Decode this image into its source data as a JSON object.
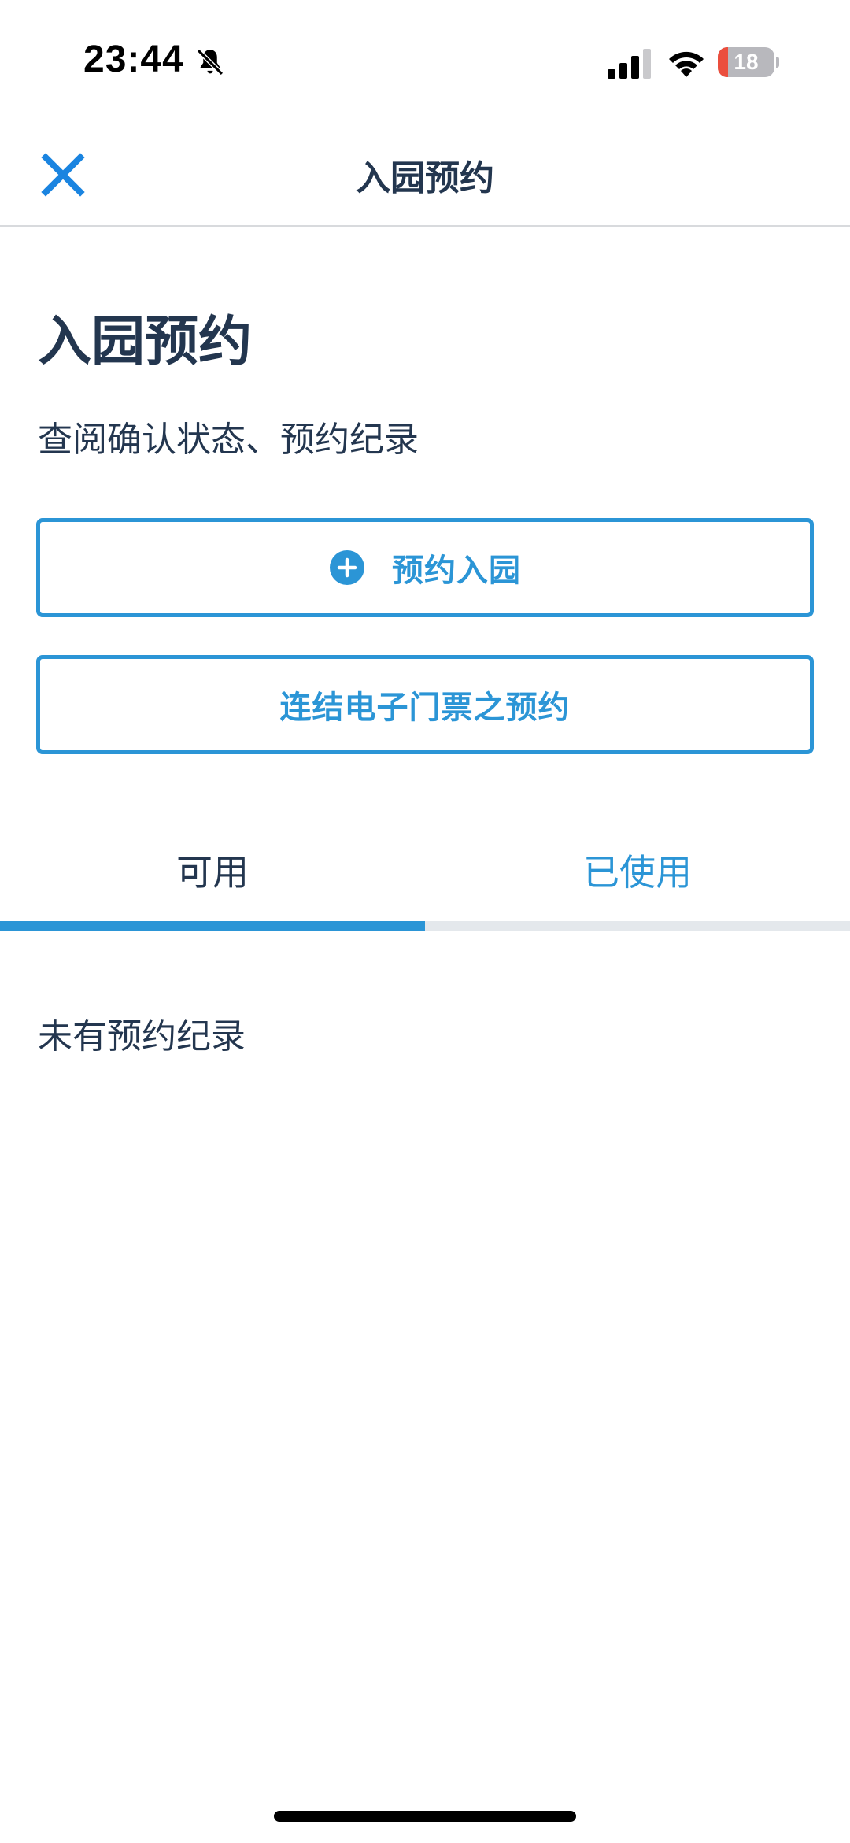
{
  "status_bar": {
    "time": "23:44",
    "battery_level": "18",
    "battery_fraction": 0.18,
    "icons": [
      "bell-slash-icon",
      "cellular-signal-icon",
      "wifi-icon",
      "battery-icon"
    ]
  },
  "header": {
    "title": "入园预约",
    "close_icon": "close-icon"
  },
  "main": {
    "title": "入园预约",
    "subtitle": "查阅确认状态、预约纪录",
    "reserve_button": {
      "label": "预约入园",
      "icon": "plus-circle-icon"
    },
    "link_button": {
      "label": "连结电子门票之预约"
    },
    "tabs": [
      {
        "label": "可用",
        "selected": true
      },
      {
        "label": "已使用",
        "selected": false
      }
    ],
    "empty_message": "未有预约纪录"
  },
  "colors": {
    "accent": "#2b95d6",
    "text": "#23364f",
    "close_icon": "#1a84e0",
    "battery_low": "#eb4e3d"
  }
}
